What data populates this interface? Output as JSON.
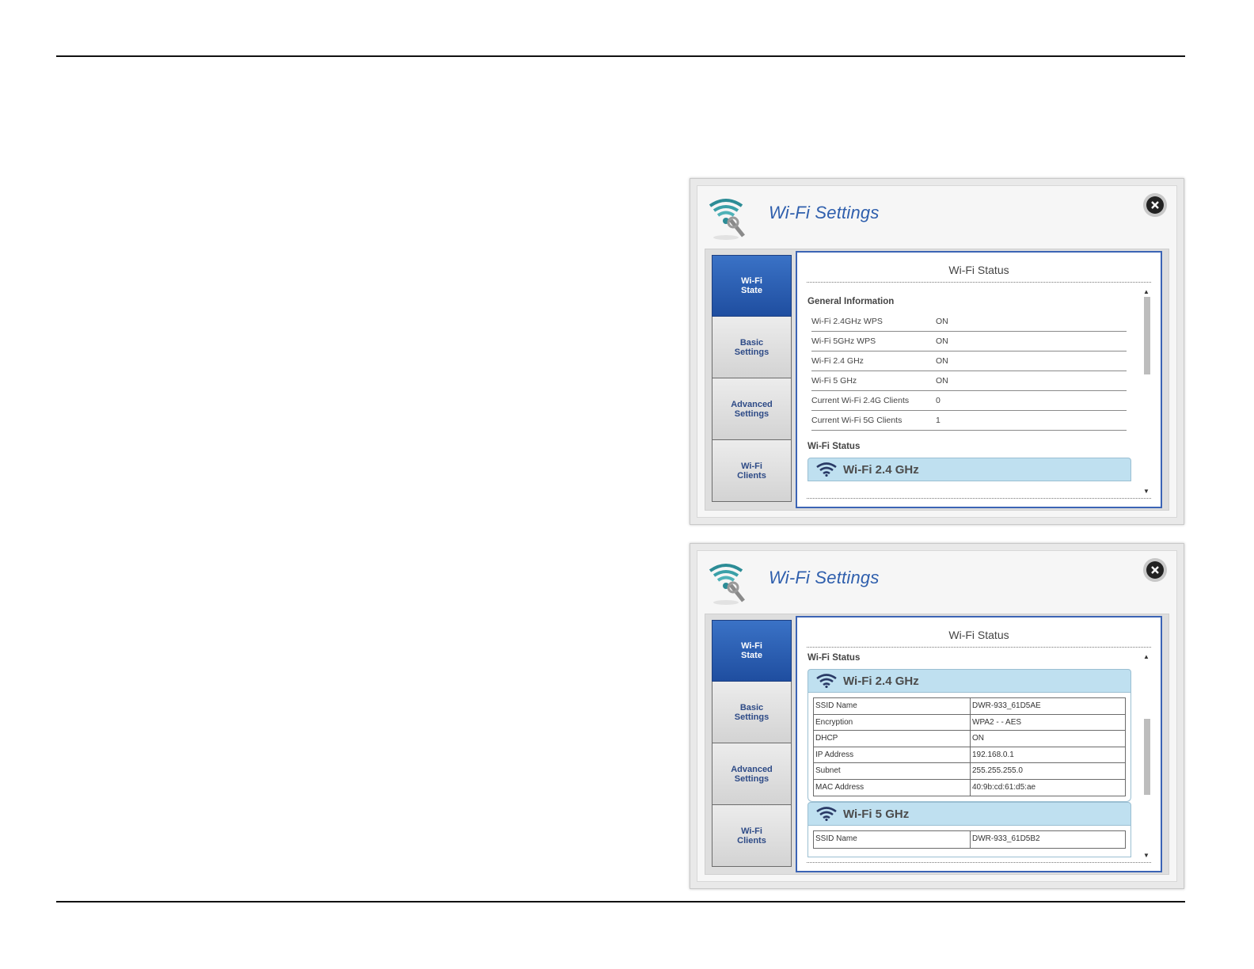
{
  "panel1": {
    "title": "Wi-Fi Settings",
    "tabs": [
      {
        "label": "Wi-Fi\nState",
        "active": true
      },
      {
        "label": "Basic\nSettings",
        "active": false
      },
      {
        "label": "Advanced\nSettings",
        "active": false
      },
      {
        "label": "Wi-Fi\nClients",
        "active": false
      }
    ],
    "pane_title": "Wi-Fi Status",
    "general_label": "General Information",
    "general_rows": [
      {
        "k": "Wi-Fi 2.4GHz WPS",
        "v": "ON"
      },
      {
        "k": "Wi-Fi 5GHz WPS",
        "v": "ON"
      },
      {
        "k": "Wi-Fi 2.4 GHz",
        "v": "ON"
      },
      {
        "k": "Wi-Fi 5 GHz",
        "v": "ON"
      },
      {
        "k": "Current Wi-Fi 2.4G Clients",
        "v": "0"
      },
      {
        "k": "Current Wi-Fi 5G Clients",
        "v": "1"
      }
    ],
    "status_label": "Wi-Fi Status",
    "band_24_title": "Wi-Fi 2.4 GHz"
  },
  "panel2": {
    "title": "Wi-Fi Settings",
    "tabs": [
      {
        "label": "Wi-Fi\nState",
        "active": true
      },
      {
        "label": "Basic\nSettings",
        "active": false
      },
      {
        "label": "Advanced\nSettings",
        "active": false
      },
      {
        "label": "Wi-Fi\nClients",
        "active": false
      }
    ],
    "pane_title": "Wi-Fi Status",
    "status_label": "Wi-Fi Status",
    "band_24_title": "Wi-Fi 2.4 GHz",
    "band_24_rows": [
      {
        "k": "SSID Name",
        "v": "DWR-933_61D5AE"
      },
      {
        "k": "Encryption",
        "v": "WPA2 - - AES"
      },
      {
        "k": "DHCP",
        "v": "ON"
      },
      {
        "k": "IP Address",
        "v": "192.168.0.1"
      },
      {
        "k": "Subnet",
        "v": "255.255.255.0"
      },
      {
        "k": "MAC Address",
        "v": "40:9b:cd:61:d5:ae"
      }
    ],
    "band_5_title": "Wi-Fi 5 GHz",
    "band_5_rows": [
      {
        "k": "SSID Name",
        "v": "DWR-933_61D5B2"
      }
    ]
  },
  "icons": {
    "app": "wifi-settings-icon",
    "close": "close-icon",
    "band": "wifi-signal-icon"
  },
  "colors": {
    "accent": "#2f5fad",
    "tab_active": "#1f4ea0",
    "band_header": "#bfe0f0"
  }
}
